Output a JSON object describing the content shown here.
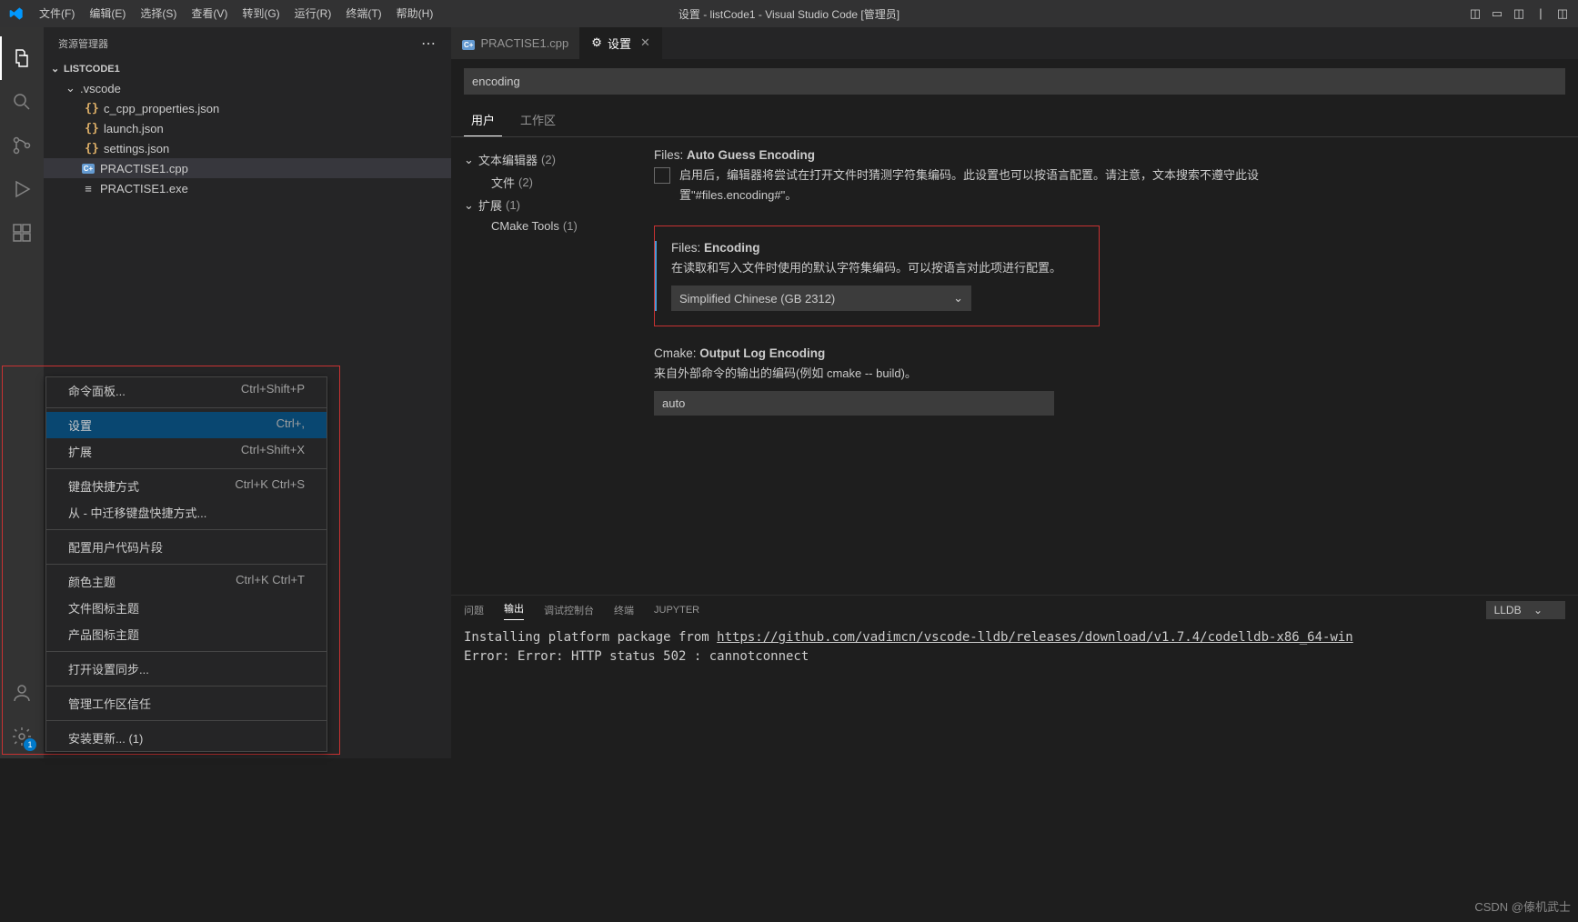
{
  "titlebar": {
    "title": "设置 - listCode1 - Visual Studio Code [管理员]",
    "menus": [
      "文件(F)",
      "编辑(E)",
      "选择(S)",
      "查看(V)",
      "转到(G)",
      "运行(R)",
      "终端(T)",
      "帮助(H)"
    ]
  },
  "sidebar": {
    "title": "资源管理器",
    "project": "LISTCODE1",
    "tree": {
      "folder_vscode": ".vscode",
      "file_cprops": "c_cpp_properties.json",
      "file_launch": "launch.json",
      "file_settings": "settings.json",
      "file_practise_cpp": "PRACTISE1.cpp",
      "file_practise_exe": "PRACTISE1.exe"
    }
  },
  "tabs": {
    "tab1": "PRACTISE1.cpp",
    "tab2": "设置"
  },
  "settings_search": {
    "value": "encoding"
  },
  "scope": {
    "user": "用户",
    "workspace": "工作区"
  },
  "toc": {
    "text_editor": "文本编辑器",
    "text_editor_count": "(2)",
    "files": "文件",
    "files_count": "(2)",
    "extensions": "扩展",
    "extensions_count": "(1)",
    "cmake": "CMake Tools",
    "cmake_count": "(1)"
  },
  "s1": {
    "cat": "Files: ",
    "name": "Auto Guess Encoding",
    "desc": "启用后，编辑器将尝试在打开文件时猜测字符集编码。此设置也可以按语言配置。请注意，文本搜索不遵守此设置\"#files.encoding#\"。"
  },
  "s2": {
    "cat": "Files: ",
    "name": "Encoding",
    "desc": "在读取和写入文件时使用的默认字符集编码。可以按语言对此项进行配置。",
    "value": "Simplified Chinese (GB 2312)"
  },
  "s3": {
    "cat": "Cmake: ",
    "name": "Output Log Encoding",
    "desc": "来自外部命令的输出的编码(例如 cmake -- build)。",
    "value": "auto"
  },
  "panel": {
    "tabs": {
      "problems": "问题",
      "output": "输出",
      "debug": "调试控制台",
      "terminal": "终端",
      "jupyter": "JUPYTER"
    },
    "select": "LLDB",
    "line1a": "Installing platform package from ",
    "line1b": "https://github.com/vadimcn/vscode-lldb/releases/download/v1.7.4/codelldb-x86_64-win",
    "line2": "Error: Error: HTTP status 502 : cannotconnect"
  },
  "context_menu": {
    "items": [
      {
        "label": "命令面板...",
        "shortcut": "Ctrl+Shift+P"
      },
      {
        "sep": true
      },
      {
        "label": "设置",
        "shortcut": "Ctrl+,",
        "hover": true
      },
      {
        "label": "扩展",
        "shortcut": "Ctrl+Shift+X"
      },
      {
        "sep": true
      },
      {
        "label": "键盘快捷方式",
        "shortcut": "Ctrl+K Ctrl+S"
      },
      {
        "label": "从 - 中迁移键盘快捷方式..."
      },
      {
        "sep": true
      },
      {
        "label": "配置用户代码片段"
      },
      {
        "sep": true
      },
      {
        "label": "颜色主题",
        "shortcut": "Ctrl+K Ctrl+T"
      },
      {
        "label": "文件图标主题"
      },
      {
        "label": "产品图标主题"
      },
      {
        "sep": true
      },
      {
        "label": "打开设置同步..."
      },
      {
        "sep": true
      },
      {
        "label": "管理工作区信任"
      },
      {
        "sep": true
      },
      {
        "label": "安装更新... (1)"
      }
    ]
  },
  "watermark": "CSDN @傣机武士",
  "badge_count": "1"
}
